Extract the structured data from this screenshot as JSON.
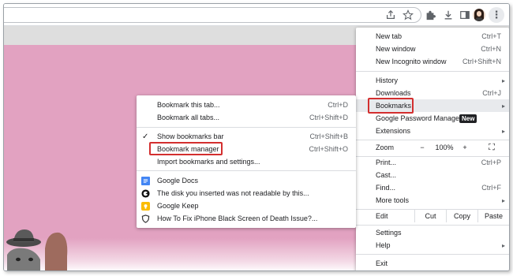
{
  "toolbar": {
    "share_icon": "share-icon",
    "star_icon": "star-icon",
    "extensions_icon": "puzzle-icon",
    "download_icon": "download-icon",
    "sidepanel_icon": "side-panel-icon",
    "menu_icon": "kebab-icon"
  },
  "chrome_menu": {
    "items": [
      {
        "label": "New tab",
        "shortcut": "Ctrl+T"
      },
      {
        "label": "New window",
        "shortcut": "Ctrl+N"
      },
      {
        "label": "New Incognito window",
        "shortcut": "Ctrl+Shift+N"
      },
      {
        "label": "History",
        "arrow": "▸"
      },
      {
        "label": "Downloads",
        "shortcut": "Ctrl+J"
      },
      {
        "label": "Bookmarks",
        "arrow": "▸"
      },
      {
        "label": "Google Password Manager",
        "badge": "New"
      },
      {
        "label": "Extensions",
        "arrow": "▸"
      },
      {
        "label": "Print...",
        "shortcut": "Ctrl+P"
      },
      {
        "label": "Cast..."
      },
      {
        "label": "Find...",
        "shortcut": "Ctrl+F"
      },
      {
        "label": "More tools",
        "arrow": "▸"
      },
      {
        "label": "Settings"
      },
      {
        "label": "Help",
        "arrow": "▸"
      },
      {
        "label": "Exit"
      }
    ],
    "zoom": {
      "label": "Zoom",
      "minus": "−",
      "value": "100%",
      "plus": "+",
      "fullscreen": "⛶"
    },
    "edit": {
      "label": "Edit",
      "cut": "Cut",
      "copy": "Copy",
      "paste": "Paste"
    }
  },
  "bookmarks_menu": {
    "items": [
      {
        "label": "Bookmark this tab...",
        "shortcut": "Ctrl+D"
      },
      {
        "label": "Bookmark all tabs...",
        "shortcut": "Ctrl+Shift+D"
      },
      {
        "label": "Show bookmarks bar",
        "shortcut": "Ctrl+Shift+B",
        "check": "✓"
      },
      {
        "label": "Bookmark manager",
        "shortcut": "Ctrl+Shift+O"
      },
      {
        "label": "Import bookmarks and settings..."
      },
      {
        "label": "Google Docs"
      },
      {
        "label": "The disk you inserted was not readable by this..."
      },
      {
        "label": "Google Keep"
      },
      {
        "label": "How To Fix iPhone Black Screen of Death Issue?..."
      }
    ]
  },
  "colors": {
    "page_background": "#e2a2c1",
    "highlight": "#d32f2f"
  }
}
